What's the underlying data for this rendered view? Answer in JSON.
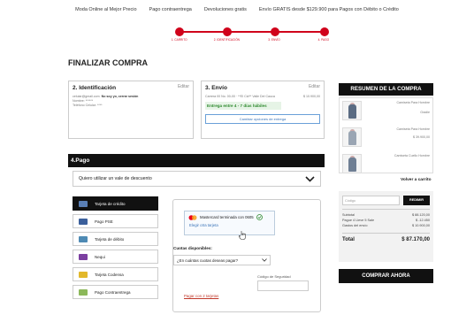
{
  "topbar": {
    "items": [
      "Moda Online al Mejor Precio",
      "Pago contraentrega",
      "Devoluciones gratis",
      "Envío GRATIS desde $129.900 para Pagos con Débito o Crédito"
    ]
  },
  "steps": [
    "1. CARRITO",
    "2. IDENTIFICACIÓN",
    "3. ENVÍO",
    "4. PAGO"
  ],
  "page_title": "FINALIZAR COMPRA",
  "identification": {
    "title": "2. Identificación",
    "edit": "Editar",
    "line1": "celular@gmail.com",
    "not_you": "No soy yo, cerrar sesión",
    "line2": "Nombre: ******",
    "line3": "Teléfono Celular: ****"
  },
  "shipping": {
    "title": "3. Envío",
    "edit": "Editar",
    "address": "Carrera 00 No. 00-00 · **El Cid** Valle Del Cauca",
    "price": "$ 10.900,00",
    "delivery": "Entrega entre 4 - 7 días hábiles",
    "change_button": "Cambiar opciones de entrega"
  },
  "payment": {
    "title": "4.Pago",
    "voucher_label": "Quiero utilizar un vale de descuento",
    "methods": [
      {
        "label": "Tarjeta de crédito",
        "color": "#5a7fb5"
      },
      {
        "label": "Pago PSE",
        "color": "#3b5f9b"
      },
      {
        "label": "Tarjeta de débito",
        "color": "#4e8ab4"
      },
      {
        "label": "Nequi",
        "color": "#7b3fa0"
      },
      {
        "label": "Tarjeta Codensa",
        "color": "#e2b82b"
      },
      {
        "label": "Pago Contraentrega",
        "color": "#8cb85a"
      }
    ],
    "selected_card": "Mastercard terminada con 0605",
    "choose_other": "Elegir otra tarjeta",
    "installments_label": "Cuotas disponibles:",
    "installments_placeholder": "¿En cuántas cuotas deseas pagar?",
    "security_label": "Código de Seguridad",
    "pay_with_two": "Pagar con 2 tarjetas"
  },
  "summary": {
    "title": "RESUMEN DE LA COMPRA",
    "items": [
      {
        "name": "Camiseta Para Hombre",
        "color": "Gradie",
        "price": ""
      },
      {
        "name": "Camiseta Para Hombre",
        "color": "",
        "price": "$ 39.900,00"
      },
      {
        "name": "Camiseta Cuello Hombre",
        "color": "",
        "price": ""
      }
    ],
    "back_to_cart": "Volver a carrito",
    "coupon_placeholder": "Código",
    "coupon_button": "REDIMIR",
    "rows": [
      {
        "label": "Subtotal",
        "value": "$ 88.120,00"
      },
      {
        "label": "Pague 4 Lleve 5 Sale",
        "value": "$ -12.450"
      },
      {
        "label": "Gastos del envío",
        "value": "$ 10.900,00"
      }
    ],
    "total_label": "Total",
    "total_value": "$ 87.170,00",
    "checkout_button": "COMPRAR AHORA"
  }
}
